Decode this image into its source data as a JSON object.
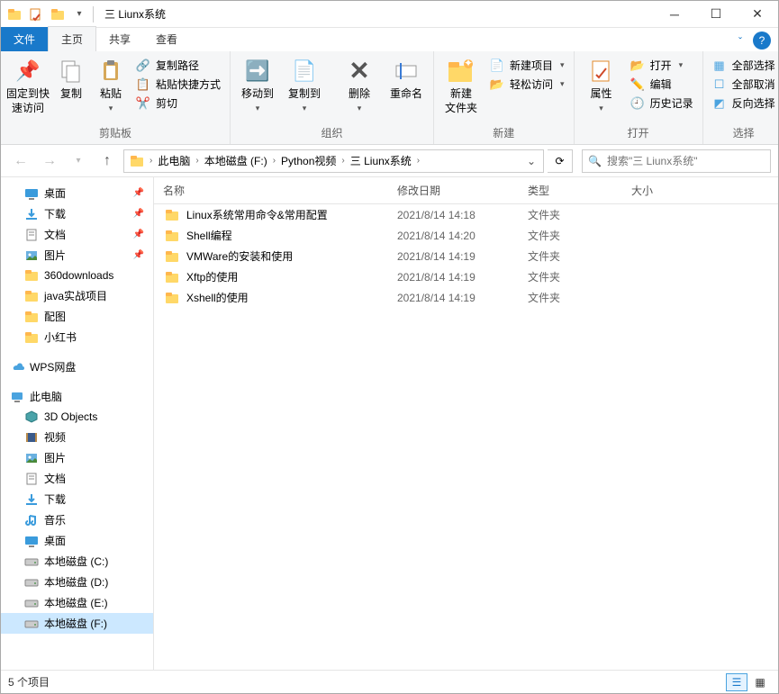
{
  "window": {
    "title": "三 Liunx系统"
  },
  "tabs": {
    "file": "文件",
    "home": "主页",
    "share": "共享",
    "view": "查看"
  },
  "ribbon": {
    "pin": "固定到快\n速访问",
    "copy": "复制",
    "paste": "粘贴",
    "copy_path": "复制路径",
    "paste_shortcut": "粘贴快捷方式",
    "cut": "剪切",
    "group_clipboard": "剪贴板",
    "move_to": "移动到",
    "copy_to": "复制到",
    "delete": "删除",
    "rename": "重命名",
    "group_organize": "组织",
    "new_folder": "新建\n文件夹",
    "new_item": "新建项目",
    "easy_access": "轻松访问",
    "group_new": "新建",
    "properties": "属性",
    "open": "打开",
    "edit": "编辑",
    "history": "历史记录",
    "group_open": "打开",
    "select_all": "全部选择",
    "select_none": "全部取消",
    "invert": "反向选择",
    "group_select": "选择"
  },
  "breadcrumbs": [
    "此电脑",
    "本地磁盘 (F:)",
    "Python视频",
    "三 Liunx系统"
  ],
  "search": {
    "placeholder": "搜索\"三 Liunx系统\""
  },
  "tree": {
    "quick": [
      {
        "label": "桌面",
        "icon": "desktop",
        "pin": true
      },
      {
        "label": "下载",
        "icon": "download",
        "pin": true
      },
      {
        "label": "文档",
        "icon": "doc",
        "pin": true
      },
      {
        "label": "图片",
        "icon": "pic",
        "pin": true
      },
      {
        "label": "360downloads",
        "icon": "folder"
      },
      {
        "label": "java实战项目",
        "icon": "folder"
      },
      {
        "label": "配图",
        "icon": "folder"
      },
      {
        "label": "小红书",
        "icon": "folder"
      }
    ],
    "wps": "WPS网盘",
    "this_pc": "此电脑",
    "pc_items": [
      {
        "label": "3D Objects",
        "icon": "3d"
      },
      {
        "label": "视频",
        "icon": "video"
      },
      {
        "label": "图片",
        "icon": "pic"
      },
      {
        "label": "文档",
        "icon": "doc"
      },
      {
        "label": "下载",
        "icon": "download"
      },
      {
        "label": "音乐",
        "icon": "music"
      },
      {
        "label": "桌面",
        "icon": "desktop"
      },
      {
        "label": "本地磁盘 (C:)",
        "icon": "drive"
      },
      {
        "label": "本地磁盘 (D:)",
        "icon": "drive"
      },
      {
        "label": "本地磁盘 (E:)",
        "icon": "drive"
      },
      {
        "label": "本地磁盘 (F:)",
        "icon": "drive",
        "selected": true
      }
    ]
  },
  "columns": {
    "name": "名称",
    "date": "修改日期",
    "type": "类型",
    "size": "大小"
  },
  "rows": [
    {
      "name": "Linux系统常用命令&常用配置",
      "date": "2021/8/14 14:18",
      "type": "文件夹"
    },
    {
      "name": "Shell编程",
      "date": "2021/8/14 14:20",
      "type": "文件夹"
    },
    {
      "name": "VMWare的安装和使用",
      "date": "2021/8/14 14:19",
      "type": "文件夹"
    },
    {
      "name": "Xftp的使用",
      "date": "2021/8/14 14:19",
      "type": "文件夹"
    },
    {
      "name": "Xshell的使用",
      "date": "2021/8/14 14:19",
      "type": "文件夹"
    }
  ],
  "status": {
    "count": "5 个项目"
  }
}
